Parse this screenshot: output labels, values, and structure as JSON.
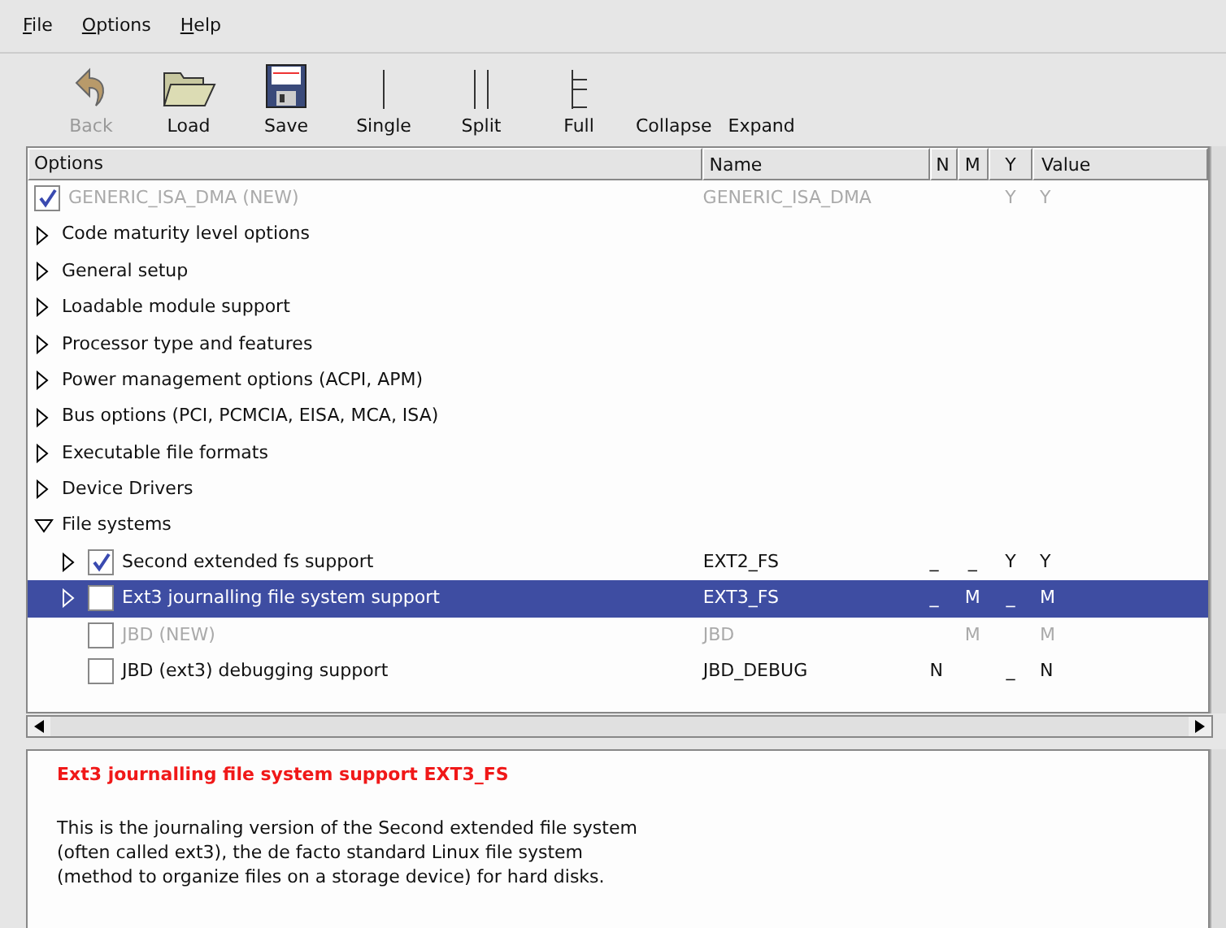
{
  "menu": [
    "File",
    "Options",
    "Help"
  ],
  "toolbar": [
    {
      "label": "Back",
      "kind": "back",
      "disabled": true
    },
    {
      "label": "Load",
      "kind": "load",
      "disabled": false
    },
    {
      "label": "Save",
      "kind": "save",
      "disabled": false
    },
    {
      "label": "Single",
      "kind": "single",
      "disabled": false
    },
    {
      "label": "Split",
      "kind": "split",
      "disabled": false
    },
    {
      "label": "Full",
      "kind": "full",
      "disabled": false
    },
    {
      "label": "Collapse",
      "kind": "text",
      "disabled": false
    },
    {
      "label": "Expand",
      "kind": "text",
      "disabled": false
    }
  ],
  "table": {
    "columns": [
      "Options",
      "Name",
      "N",
      "M",
      "Y",
      "Value"
    ],
    "rows": [
      {
        "kind": "option",
        "label": "GENERIC_ISA_DMA (NEW)",
        "name": "GENERIC_ISA_DMA",
        "y": "Y",
        "value": "Y",
        "checked": true,
        "disabled": true,
        "selected": false
      },
      {
        "kind": "menu",
        "label": "Code maturity level options",
        "expanded": false,
        "selected": false
      },
      {
        "kind": "menu",
        "label": "General setup",
        "expanded": false,
        "selected": false
      },
      {
        "kind": "menu",
        "label": "Loadable module support",
        "expanded": false,
        "selected": false
      },
      {
        "kind": "menu",
        "label": "Processor type and features",
        "expanded": false,
        "selected": false
      },
      {
        "kind": "menu",
        "label": "Power management options (ACPI, APM)",
        "expanded": false,
        "selected": false
      },
      {
        "kind": "menu",
        "label": "Bus options (PCI, PCMCIA, EISA, MCA, ISA)",
        "expanded": false,
        "selected": false
      },
      {
        "kind": "menu",
        "label": "Executable file formats",
        "expanded": false,
        "selected": false
      },
      {
        "kind": "menu",
        "label": "Device Drivers",
        "expanded": false,
        "selected": false
      },
      {
        "kind": "menu",
        "label": "File systems",
        "expanded": true,
        "selected": false,
        "children": [
          {
            "kind": "option",
            "label": "Second extended fs support",
            "name": "EXT2_FS",
            "n": "_",
            "m": "_",
            "y": "Y",
            "value": "Y",
            "checked": true,
            "disabled": false,
            "selected": false,
            "expandable": true
          },
          {
            "kind": "option",
            "label": "Ext3 journalling file system support",
            "name": "EXT3_FS",
            "n": "_",
            "m": "M",
            "y": "_",
            "value": "M",
            "checked": false,
            "disabled": false,
            "selected": true,
            "expandable": true
          },
          {
            "kind": "option",
            "label": "JBD (NEW)",
            "name": "JBD",
            "m": "M",
            "value": "M",
            "checked": false,
            "disabled": true,
            "selected": false,
            "expandable": false
          },
          {
            "kind": "option",
            "label": "JBD (ext3) debugging support",
            "name": "JBD_DEBUG",
            "n": "N",
            "y": "_",
            "value": "N",
            "checked": false,
            "disabled": false,
            "selected": false,
            "expandable": false
          }
        ]
      }
    ]
  },
  "help": {
    "title": "Ext3 journalling file system support EXT3_FS",
    "paragraphs": [
      "This is the journaling version of the Second extended file system\n(often called ext3), the de facto standard Linux file system\n(method to organize files on a storage device) for hard disks."
    ]
  }
}
